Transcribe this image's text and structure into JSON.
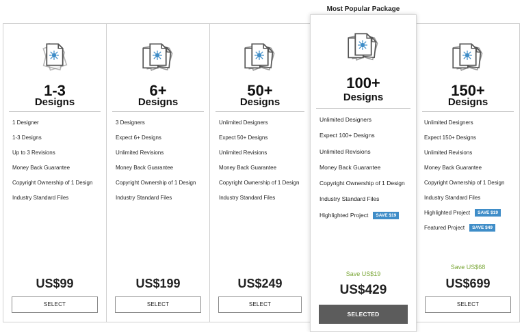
{
  "popular_label": "Most Popular Package",
  "plans": [
    {
      "icon": "single-design-icon",
      "qty": "1-3",
      "unit": "Designs",
      "features": [
        "1 Designer",
        "1-3 Designs",
        "Up to 3 Revisions",
        "Money Back Guarantee",
        "Copyright Ownership of 1 Design",
        "Industry Standard Files"
      ],
      "price": "US$99",
      "button": "SELECT"
    },
    {
      "icon": "design-stack-icon",
      "qty": "6+",
      "unit": "Designs",
      "features": [
        "3 Designers",
        "Expect 6+ Designs",
        "Unlimited Revisions",
        "Money Back Guarantee",
        "Copyright Ownership of 1 Design",
        "Industry Standard Files"
      ],
      "price": "US$199",
      "button": "SELECT"
    },
    {
      "icon": "design-stack-icon",
      "qty": "50+",
      "unit": "Designs",
      "features": [
        "Unlimited Designers",
        "Expect 50+ Designs",
        "Unlimited Revisions",
        "Money Back Guarantee",
        "Copyright Ownership of 1 Design",
        "Industry Standard Files"
      ],
      "price": "US$249",
      "button": "SELECT"
    },
    {
      "icon": "design-stack-icon",
      "qty": "100+",
      "unit": "Designs",
      "features": [
        "Unlimited Designers",
        "Expect 100+ Designs",
        "Unlimited Revisions",
        "Money Back Guarantee",
        "Copyright Ownership of 1 Design",
        "Industry Standard Files",
        "Highlighted Project"
      ],
      "badges": {
        "highlighted": "SAVE $19"
      },
      "save": "Save US$19",
      "price": "US$429",
      "button": "SELECTED"
    },
    {
      "icon": "design-stack-icon",
      "qty": "150+",
      "unit": "Designs",
      "features": [
        "Unlimited Designers",
        "Expect 150+ Designs",
        "Unlimited Revisions",
        "Money Back Guarantee",
        "Copyright Ownership of 1 Design",
        "Industry Standard Files",
        "Highlighted Project",
        "Featured Project"
      ],
      "badges": {
        "highlighted": "SAVE $19",
        "featured": "SAVE $49"
      },
      "save": "Save US$68",
      "price": "US$699",
      "button": "SELECT"
    }
  ],
  "colors": {
    "accent_blue": "#3f8dc8",
    "save_green": "#78a534",
    "selected_button": "#5c5c5c",
    "border": "#cfcfcf"
  }
}
